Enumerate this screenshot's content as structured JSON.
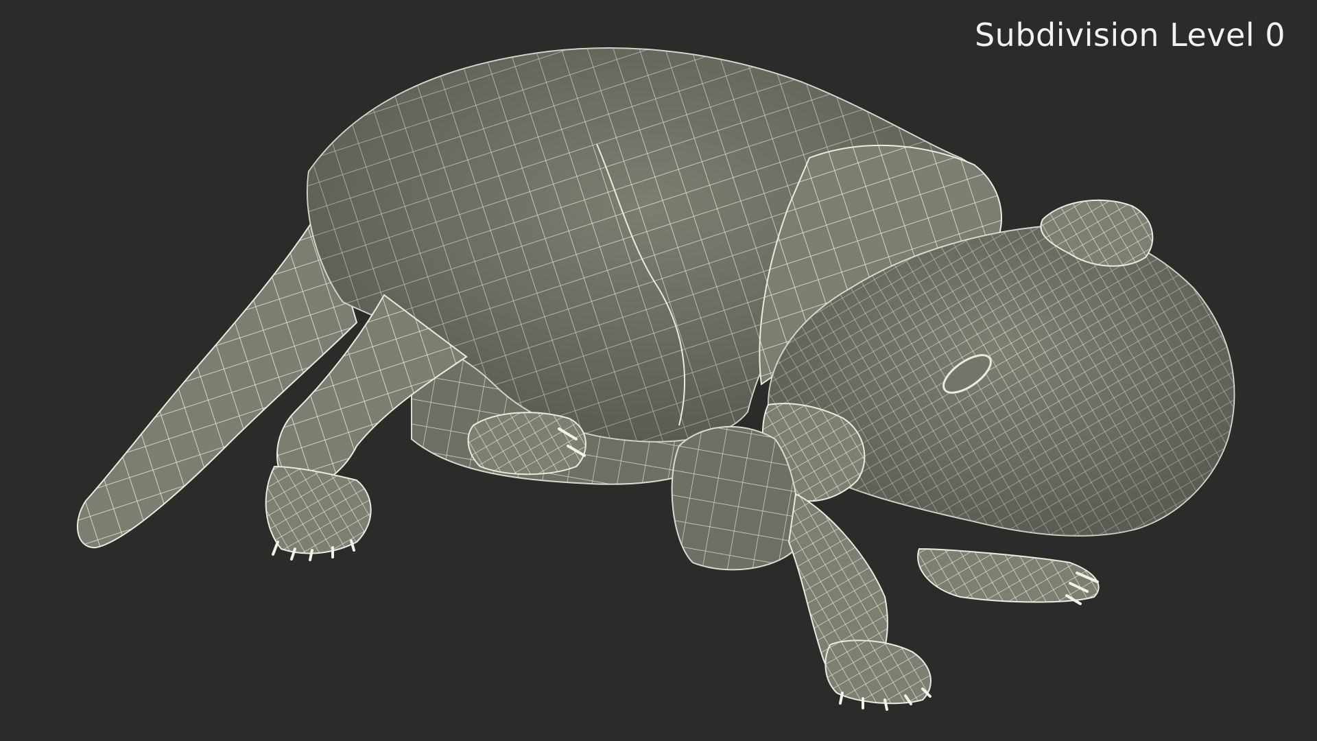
{
  "viewport": {
    "label": "Subdivision Level 0",
    "background_color": "#2b2b2a",
    "mesh_fill_color": "#7d7e72",
    "wire_color": "#ecebe0"
  }
}
